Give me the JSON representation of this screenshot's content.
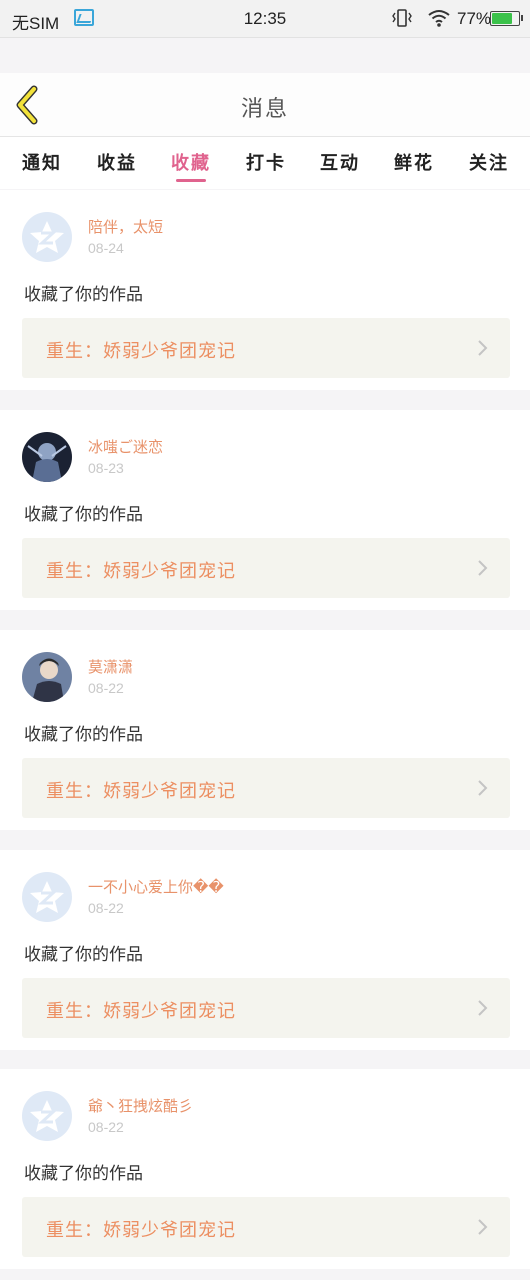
{
  "status_bar": {
    "carrier": "无SIM",
    "time": "12:35",
    "battery": "77%",
    "battery_level": 0.77
  },
  "header": {
    "title": "消息"
  },
  "tabs": [
    {
      "label": "通知"
    },
    {
      "label": "收益"
    },
    {
      "label": "收藏",
      "active": true
    },
    {
      "label": "打卡"
    },
    {
      "label": "互动"
    },
    {
      "label": "鲜花"
    },
    {
      "label": "关注"
    }
  ],
  "messages": [
    {
      "user": "陪伴，太短",
      "date": "08-24",
      "action": "收藏了你的作品",
      "work": "重生：娇弱少爷团宠记",
      "avatar": "default-avatar-icon"
    },
    {
      "user": "冰嗤ご迷恋",
      "date": "08-23",
      "action": "收藏了你的作品",
      "work": "重生：娇弱少爷团宠记",
      "avatar": "photo-avatar"
    },
    {
      "user": "莫潇潇",
      "date": "08-22",
      "action": "收藏了你的作品",
      "work": "重生：娇弱少爷团宠记",
      "avatar": "photo-avatar"
    },
    {
      "user": "一不小心爱上你��",
      "date": "08-22",
      "action": "收藏了你的作品",
      "work": "重生：娇弱少爷团宠记",
      "avatar": "default-avatar-icon"
    },
    {
      "user": "爺丶狂拽炫酷彡",
      "date": "08-22",
      "action": "收藏了你的作品",
      "work": "重生：娇弱少爷团宠记",
      "avatar": "default-avatar-icon"
    }
  ],
  "colors": {
    "accent": "#e0638e",
    "username": "#e8926a",
    "work_title": "#ec8f62",
    "back_icon": "#f2e23a"
  }
}
